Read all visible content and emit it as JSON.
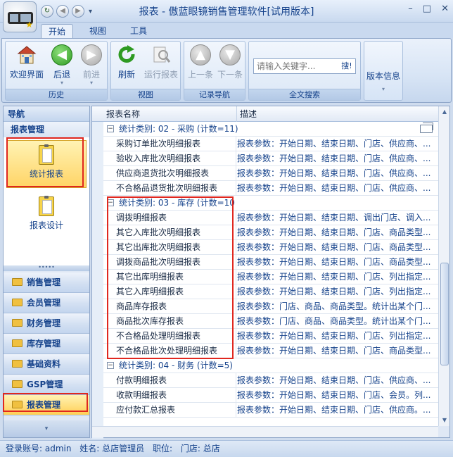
{
  "window": {
    "title": "报表 - 傲蓝眼镜销售管理软件[试用版本]",
    "minimize": "–",
    "maximize": "□",
    "close": "✕"
  },
  "quick_access": [
    "↻",
    "◀",
    "▶",
    "▾"
  ],
  "ribbon_tabs": [
    "开始",
    "视图",
    "工具"
  ],
  "ribbon": {
    "groups": {
      "history": "历史",
      "view": "视图",
      "record_nav": "记录导航",
      "search": "全文搜索"
    },
    "buttons": {
      "welcome": "欢迎界面",
      "back": "后退",
      "forward": "前进",
      "refresh": "刷新",
      "run_report": "运行报表",
      "prev_record": "上一条",
      "next_record": "下一条",
      "version_info": "版本信息"
    },
    "search_placeholder": "请输入关键字...",
    "search_button": "搜!"
  },
  "nav": {
    "header": "导航",
    "section": "报表管理",
    "tiles": [
      "统计报表",
      "报表设计"
    ],
    "modules": [
      "销售管理",
      "会员管理",
      "财务管理",
      "库存管理",
      "基础资料",
      "GSP管理",
      "报表管理"
    ],
    "splitter": "•••••",
    "footer": "▾"
  },
  "grid": {
    "columns": [
      "报表名称",
      "描述"
    ],
    "groups": [
      {
        "label": "统计类别: 02 - 采购 (计数=11)",
        "rows": [
          [
            "采购订单批次明细报表",
            "报表参数：开始日期、结束日期、门店、供应商、..."
          ],
          [
            "验收入库批次明细报表",
            "报表参数：开始日期、结束日期、门店、供应商、..."
          ],
          [
            "供应商退货批次明细报表",
            "报表参数：开始日期、结束日期、门店、供应商、..."
          ],
          [
            "不合格品退货批次明细报表",
            "报表参数：开始日期、结束日期、门店、供应商、..."
          ]
        ]
      },
      {
        "label": "统计类别: 03 - 库存 (计数=10",
        "rows": [
          [
            "调拨明细报表",
            "报表参数：开始日期、结束日期、调出门店、调入..."
          ],
          [
            "其它入库批次明细报表",
            "报表参数：开始日期、结束日期、门店、商品类型..."
          ],
          [
            "其它出库批次明细报表",
            "报表参数：开始日期、结束日期、门店、商品类型..."
          ],
          [
            "调拨商品批次明细报表",
            "报表参数：开始日期、结束日期、门店、商品类型..."
          ],
          [
            "其它出库明细报表",
            "报表参数：开始日期、结束日期、门店、列出指定..."
          ],
          [
            "其它入库明细报表",
            "报表参数：开始日期、结束日期、门店、列出指定..."
          ],
          [
            "商品库存报表",
            "报表参数：门店、商品、商品类型。统计出某个门..."
          ],
          [
            "商品批次库存报表",
            "报表参数：门店、商品、商品类型。统计出某个门..."
          ],
          [
            "不合格品处理明细报表",
            "报表参数：开始日期、结束日期、门店、列出指定..."
          ],
          [
            "不合格品批次处理明细报表",
            "报表参数：开始日期、结束日期、门店、商品类型..."
          ]
        ]
      },
      {
        "label": "统计类别: 04 - 财务 (计数=5)",
        "rows": [
          [
            "付款明细报表",
            "报表参数：开始日期、结束日期、门店、供应商、..."
          ],
          [
            "收款明细报表",
            "报表参数：开始日期、结束日期、门店、会员。列..."
          ],
          [
            "应付款汇总报表",
            "报表参数：开始日期、结束日期、门店、供应商。..."
          ]
        ]
      }
    ]
  },
  "status": {
    "account": "登录账号: admin",
    "name": "姓名: 总店管理员",
    "position": "职位:",
    "store": "门店: 总店"
  },
  "colors": {
    "accent": "#15428b",
    "highlight": "#e0271f",
    "selected": "#ffd466"
  }
}
